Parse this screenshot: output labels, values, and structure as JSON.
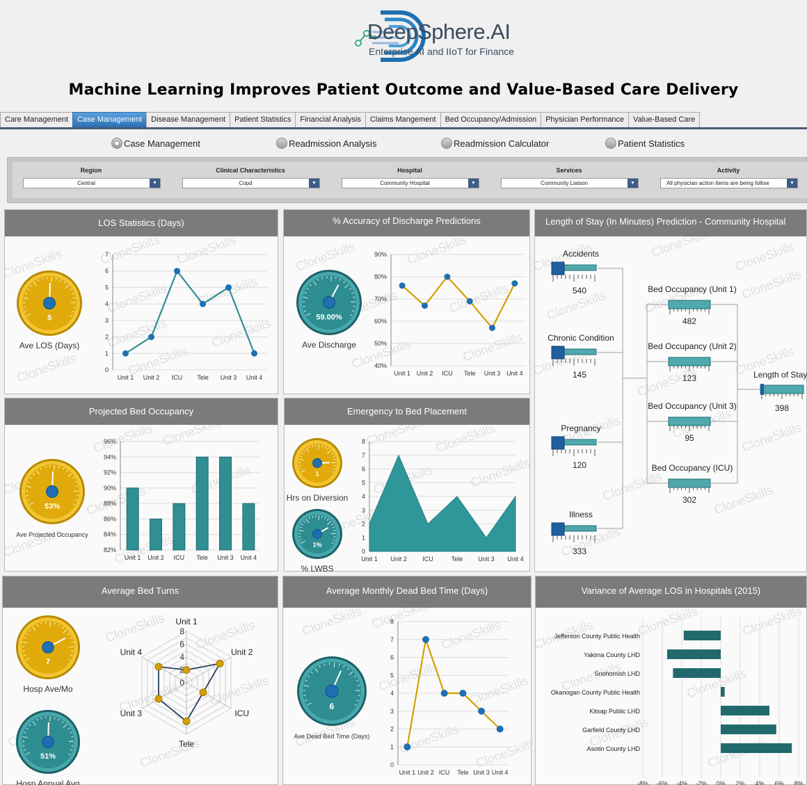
{
  "brand": {
    "name": "DeepSphere.AI",
    "tagline": "Enterprise AI and IIoT for Finance"
  },
  "title": "Machine Learning Improves Patient Outcome and Value-Based Care Delivery",
  "tabs": [
    "Care Management",
    "Case Management",
    "Disease Management",
    "Patient Statistics",
    "Financial Analysis",
    "Claims Mangement",
    "Bed Occupancy/Admission",
    "Physician Performance",
    "Value-Based Care"
  ],
  "active_tab": "Case Management",
  "radios": [
    {
      "label": "Case Management",
      "selected": true
    },
    {
      "label": "Readmission Analysis",
      "selected": false
    },
    {
      "label": "Readmission Calculator",
      "selected": false
    },
    {
      "label": "Patient Statistics",
      "selected": false
    }
  ],
  "filters": [
    {
      "label": "Region",
      "value": "Central"
    },
    {
      "label": "Clinical Characteristics",
      "value": "Copd"
    },
    {
      "label": "Hospital",
      "value": "Community Hospital"
    },
    {
      "label": "Services",
      "value": "Community Liaison"
    },
    {
      "label": "Activity",
      "value": "All physician action items are being follow"
    }
  ],
  "watermark": "CloneSkills",
  "colors": {
    "gold": "#d4a000",
    "teal": "#2f8f93",
    "dark_teal": "#1f6e72",
    "blue": "#1f6fb2",
    "header_gray": "#7b7b7b"
  },
  "panels": {
    "los": {
      "title": "LOS Statistics (Days)",
      "gauge_value": "5",
      "gauge_label": "Ave LOS (Days)"
    },
    "accuracy": {
      "title": "% Accuracy of Discharge Predictions",
      "gauge_value": "59.00%",
      "gauge_label": "Ave Discharge"
    },
    "length_of_stay": {
      "title": "Length of Stay (In Minutes) Prediction - Community Hospital"
    },
    "projected": {
      "title": "Projected Bed Occupancy",
      "gauge_value": "53%",
      "gauge_label": "Ave Projected Occupancy"
    },
    "emergency": {
      "title": "Emergency to Bed Placement",
      "gauge1_value": "1",
      "gauge1_label": "Hrs on Diversion",
      "gauge2_value": "1%",
      "gauge2_label": "% LWBS"
    },
    "bed_turns": {
      "title": "Average Bed Turns",
      "gauge1_value": "7",
      "gauge1_label": "Hosp Ave/Mo",
      "gauge2_value": "51%",
      "gauge2_label": "Hosp Annual Avg"
    },
    "dead_bed": {
      "title": "Average Monthly Dead Bed Time (Days)",
      "gauge_value": "6",
      "gauge_label": "Ave Dead Bed Time (Days)"
    },
    "variance": {
      "title": "Variance of Average LOS in Hospitals (2015)"
    }
  },
  "chart_data": [
    {
      "id": "los",
      "type": "line",
      "categories": [
        "Unit 1",
        "Unit 2",
        "ICU",
        "Tele",
        "Unit 3",
        "Unit 4"
      ],
      "values": [
        1,
        2,
        6,
        4,
        5,
        1
      ],
      "ylim": [
        0,
        7
      ],
      "yticks": [
        "0",
        "1",
        "2",
        "3",
        "4",
        "5",
        "6",
        "7"
      ]
    },
    {
      "id": "accuracy",
      "type": "line",
      "categories": [
        "Unit 1",
        "Unit 2",
        "ICU",
        "Tele",
        "Unit 3",
        "Unit 4"
      ],
      "values": [
        76,
        67,
        80,
        69,
        57,
        77
      ],
      "ylim": [
        40,
        90
      ],
      "yticks": [
        "40%",
        "50%",
        "60%",
        "70%",
        "80%",
        "90%"
      ]
    },
    {
      "id": "los_prediction",
      "type": "tree",
      "inputs": [
        {
          "label": "Accidents",
          "value": "540"
        },
        {
          "label": "Chronic Condition",
          "value": "145"
        },
        {
          "label": "Pregnancy",
          "value": "120"
        },
        {
          "label": "Illness",
          "value": "333"
        }
      ],
      "middle": [
        {
          "label": "Bed Occupancy (Unit 1)",
          "value": "482"
        },
        {
          "label": "Bed Occupancy (Unit 2)",
          "value": "123"
        },
        {
          "label": "Bed Occupancy (Unit 3)",
          "value": "95"
        },
        {
          "label": "Bed Occupancy (ICU)",
          "value": "302"
        }
      ],
      "output": {
        "label": "Length of Stay",
        "value": "398"
      }
    },
    {
      "id": "projected",
      "type": "bar",
      "categories": [
        "Unit 1",
        "Unit 2",
        "ICU",
        "Tele",
        "Unit 3",
        "Unit 4"
      ],
      "values": [
        90,
        86,
        88,
        94,
        94,
        88
      ],
      "ylim": [
        82,
        96
      ],
      "yticks": [
        "82%",
        "84%",
        "86%",
        "88%",
        "90%",
        "92%",
        "94%",
        "96%"
      ]
    },
    {
      "id": "emergency",
      "type": "area",
      "categories": [
        "Unit 1",
        "Unit 2",
        "ICU",
        "Tele",
        "Unit 3",
        "Unit 4"
      ],
      "x": [
        0,
        1,
        2,
        3,
        4,
        5
      ],
      "points": [
        [
          0,
          2
        ],
        [
          1,
          7
        ],
        [
          2,
          2
        ],
        [
          3,
          4
        ],
        [
          4,
          1
        ],
        [
          5,
          4
        ]
      ],
      "ylim": [
        0,
        8
      ],
      "yticks": [
        "0",
        "1",
        "2",
        "3",
        "4",
        "5",
        "6",
        "7",
        "8"
      ]
    },
    {
      "id": "bed_turns",
      "type": "radar",
      "categories": [
        "Unit 1",
        "Unit 2",
        "ICU",
        "Tele",
        "Unit 3",
        "Unit 4"
      ],
      "values": [
        2,
        6,
        3,
        6,
        5,
        5
      ],
      "rlim": [
        0,
        8
      ],
      "rticks": [
        "0",
        "2",
        "4",
        "6",
        "8"
      ]
    },
    {
      "id": "dead_bed",
      "type": "line",
      "categories": [
        "Unit 1",
        "Unit 2",
        "ICU",
        "Tele",
        "Unit 3",
        "Unit 4"
      ],
      "values": [
        1,
        7,
        4,
        4,
        3,
        2
      ],
      "ylim": [
        0,
        8
      ],
      "yticks": [
        "0",
        "1",
        "2",
        "3",
        "4",
        "5",
        "6",
        "7",
        "8"
      ]
    },
    {
      "id": "variance",
      "type": "bar",
      "orientation": "horizontal",
      "categories": [
        "Jefferson County Public Health",
        "Yakima County LHD",
        "Snohomish LHD",
        "Okanogan County Public Health",
        "Kitsap Public LHD",
        "Garfield County LHD",
        "Asotin County LHD"
      ],
      "values": [
        -3.8,
        -5.5,
        -4.9,
        0.4,
        5.0,
        5.7,
        7.3
      ],
      "xlim": [
        -8,
        8
      ],
      "xticks": [
        "-8%",
        "-6%",
        "-4%",
        "-2%",
        "0%",
        "2%",
        "4%",
        "6%",
        "8%"
      ]
    }
  ]
}
